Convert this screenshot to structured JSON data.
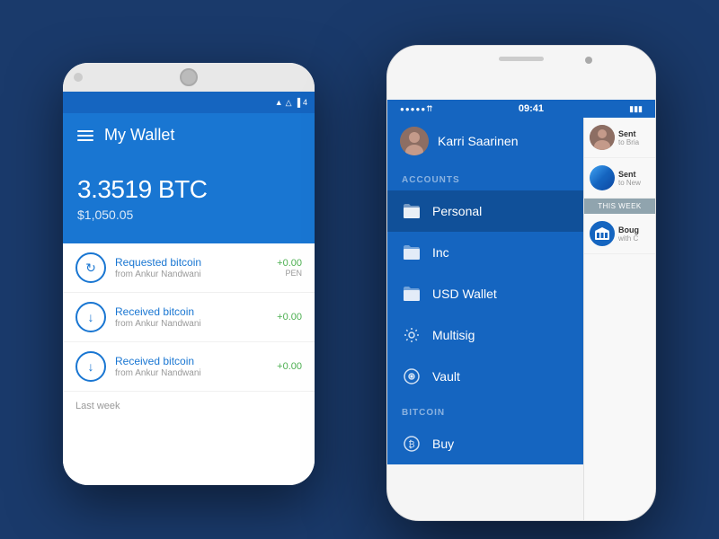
{
  "background_color": "#1a3a6b",
  "android": {
    "header_title": "My Wallet",
    "btc_amount": "3.3519 BTC",
    "usd_amount": "$1,050.05",
    "transactions": [
      {
        "type": "request",
        "title": "Requested bitcoin",
        "subtitle": "from Ankur Nandwani",
        "amount": "+0.00",
        "status": "PEN",
        "icon": "↻"
      },
      {
        "type": "receive",
        "title": "Received bitcoin",
        "subtitle": "from Ankur Nandwani",
        "amount": "+0.00",
        "status": "",
        "icon": "↓"
      },
      {
        "type": "receive",
        "title": "Received bitcoin",
        "subtitle": "from Ankur Nandwani",
        "amount": "+0.00",
        "status": "",
        "icon": "↓"
      }
    ],
    "last_week_label": "Last week"
  },
  "iphone": {
    "status_time": "09:41",
    "status_signal": "●●●●●",
    "status_wifi": "▲",
    "status_battery": "■■■",
    "user_name": "Karri Saarinen",
    "accounts_label": "ACCOUNTS",
    "menu_items": [
      {
        "label": "Personal",
        "icon": "🗂",
        "active": true
      },
      {
        "label": "Inc",
        "icon": "🗂",
        "active": false
      },
      {
        "label": "USD Wallet",
        "icon": "🗂",
        "active": false
      },
      {
        "label": "Multisig",
        "icon": "⚙",
        "active": false
      },
      {
        "label": "Vault",
        "icon": "⊕",
        "active": false
      }
    ],
    "bitcoin_label": "BITCOIN",
    "bitcoin_items": [
      {
        "label": "Buy",
        "icon": "₿",
        "active": false
      }
    ],
    "peek_transactions": [
      {
        "title": "Sent",
        "sub": "to Bria",
        "avatar_type": "person"
      },
      {
        "title": "Sent",
        "sub": "to New",
        "avatar_type": "landscape"
      }
    ],
    "this_week_label": "THIS WEEK",
    "peek_this_week": [
      {
        "title": "Boug",
        "sub": "with C",
        "avatar_type": "bank"
      }
    ]
  }
}
